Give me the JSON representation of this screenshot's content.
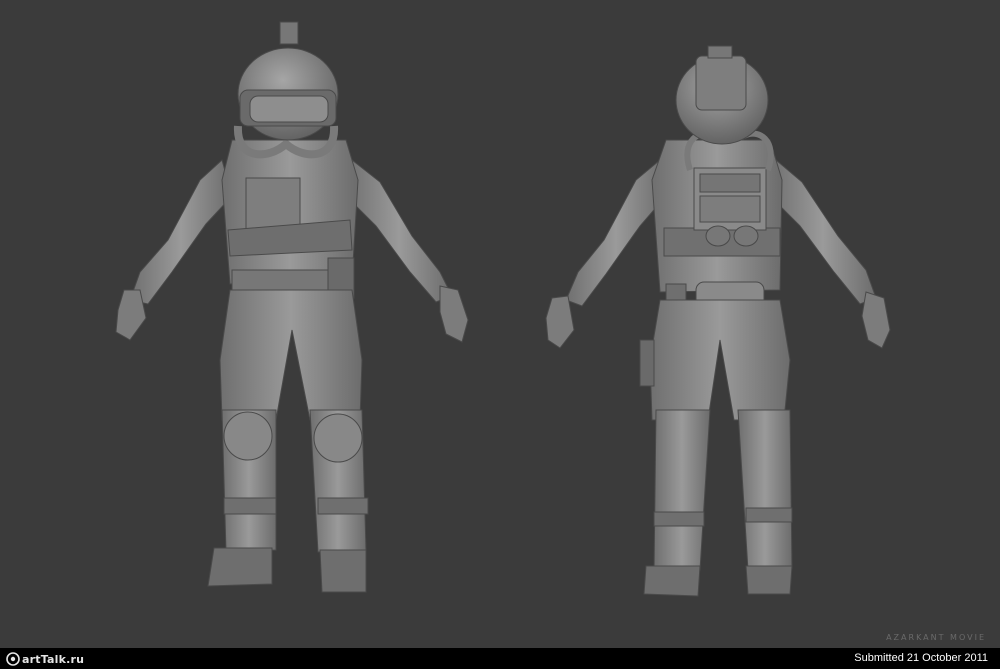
{
  "image": {
    "subject": "",
    "colors": {
      "background": "#3b3b3b",
      "model": "#8a8a8a",
      "footer": "#000000"
    }
  },
  "watermark": {
    "project": "AZARKANT MOVIE"
  },
  "footer": {
    "logo_text": "artTalk.ru",
    "submitted": "Submitted 21 October 2011"
  }
}
